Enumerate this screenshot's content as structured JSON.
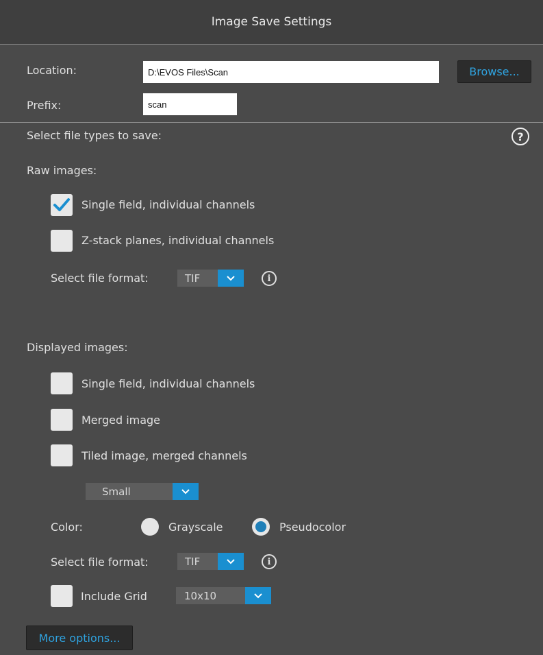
{
  "header": {
    "title": "Image Save Settings"
  },
  "location": {
    "label": "Location:",
    "value": "D:\\EVOS Files\\Scan",
    "browse_label": "Browse..."
  },
  "prefix": {
    "label": "Prefix:",
    "value": "scan"
  },
  "file_types": {
    "label": "Select file types to save:",
    "help_icon": "?"
  },
  "raw": {
    "heading": "Raw images:",
    "single_field": {
      "label": "Single field, individual channels",
      "checked": true
    },
    "zstack": {
      "label": "Z-stack planes, individual channels",
      "checked": false
    },
    "format_label": "Select file format:",
    "format_value": "TIF",
    "info_icon": "i"
  },
  "displayed": {
    "heading": "Displayed images:",
    "single_field": {
      "label": "Single field, individual channels",
      "checked": false
    },
    "merged": {
      "label": "Merged image",
      "checked": false
    },
    "tiled": {
      "label": "Tiled image, merged channels",
      "checked": false
    },
    "tile_size": "Small",
    "color_label": "Color:",
    "grayscale_label": "Grayscale",
    "pseudocolor_label": "Pseudocolor",
    "color_selected": "Pseudocolor",
    "format_label": "Select file format:",
    "format_value": "TIF",
    "info_icon": "i",
    "include_grid": {
      "label": "Include Grid",
      "checked": false
    },
    "grid_value": "10x10"
  },
  "more_options_label": "More options...",
  "colors": {
    "accent": "#1a8fd0",
    "link": "#2fa3e0",
    "background": "#4a4a4a"
  }
}
